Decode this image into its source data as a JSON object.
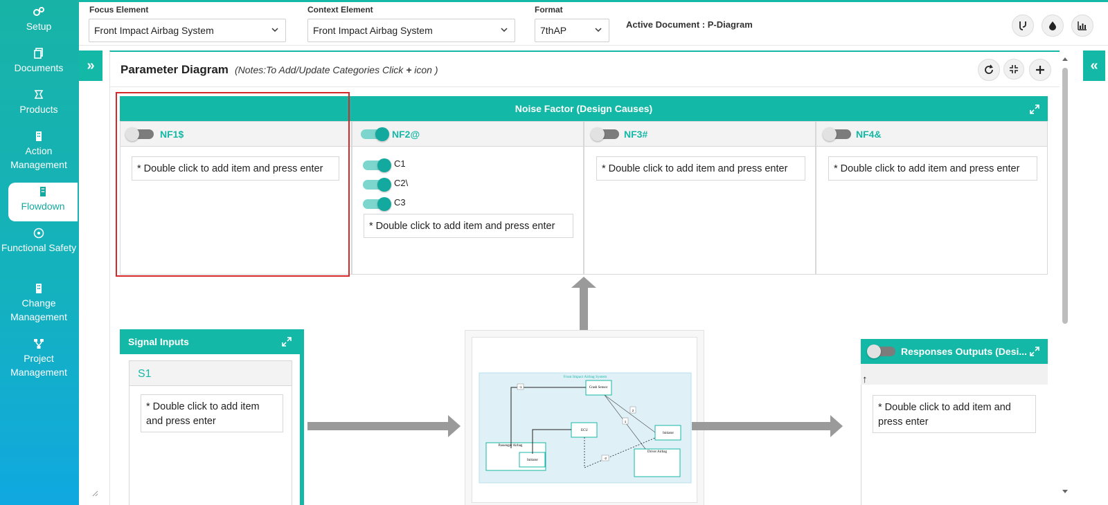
{
  "sidebar": {
    "items": [
      {
        "label": "Setup",
        "icon": "cog-icon"
      },
      {
        "label": "Documents",
        "icon": "documents-icon"
      },
      {
        "label": "Products",
        "icon": "products-icon"
      },
      {
        "label": "Action Management",
        "icon": "building-icon"
      },
      {
        "label": "Flowdown",
        "icon": "building-icon",
        "active": true
      },
      {
        "label": "Functional Safety",
        "icon": "safety-icon"
      },
      {
        "label": "Change Management",
        "icon": "building-icon"
      },
      {
        "label": "Project Management",
        "icon": "hierarchy-icon"
      }
    ]
  },
  "topbar": {
    "focus_label": "Focus Element",
    "focus_value": "Front Impact Airbag System",
    "context_label": "Context Element",
    "context_value": "Front Impact Airbag System",
    "format_label": "Format",
    "format_value": "7thAP",
    "active_doc_label": "Active Document : P-Diagram",
    "buttons": [
      "branch-icon",
      "drop-icon",
      "chart-icon"
    ]
  },
  "panel": {
    "title": "Parameter Diagram",
    "note_prefix": "(Notes:To Add/Update Categories Click ",
    "note_plus": "+",
    "note_suffix": " icon )",
    "actions": [
      "refresh-icon",
      "compress-icon",
      "plus-icon"
    ]
  },
  "noise": {
    "header": "Noise Factor (Design Causes)",
    "columns": [
      {
        "title": "NF1$",
        "toggle_on": false,
        "items": [],
        "add_text": "* Double click to add item and press enter"
      },
      {
        "title": "NF2@",
        "toggle_on": true,
        "items": [
          "C1",
          "C2\\",
          "C3"
        ],
        "add_text": "* Double click to add item and press enter"
      },
      {
        "title": "NF3#",
        "toggle_on": false,
        "items": [],
        "add_text": "* Double click to add item and press enter"
      },
      {
        "title": "NF4&",
        "toggle_on": false,
        "items": [],
        "add_text": "* Double click to add item and press enter"
      }
    ]
  },
  "signal": {
    "header": "Signal Inputs",
    "sub_title": "S1",
    "add_text": "* Double click to add item and press enter"
  },
  "responses": {
    "header": "Responses Outputs (Desi...",
    "sort_glyph": "↑",
    "add_text": "* Double click to add item and press enter"
  },
  "diagram": {
    "title": "Front Impact Airbag System",
    "nodes": [
      "Crash Sensor",
      "ECU",
      "Initiator",
      "Passenger Airbag",
      "Initiator",
      "Driver Airbag"
    ],
    "edge_labels": [
      "-1",
      "2",
      "1",
      "-2"
    ]
  },
  "colors": {
    "accent": "#14b8a6",
    "highlight": "#d62828"
  }
}
